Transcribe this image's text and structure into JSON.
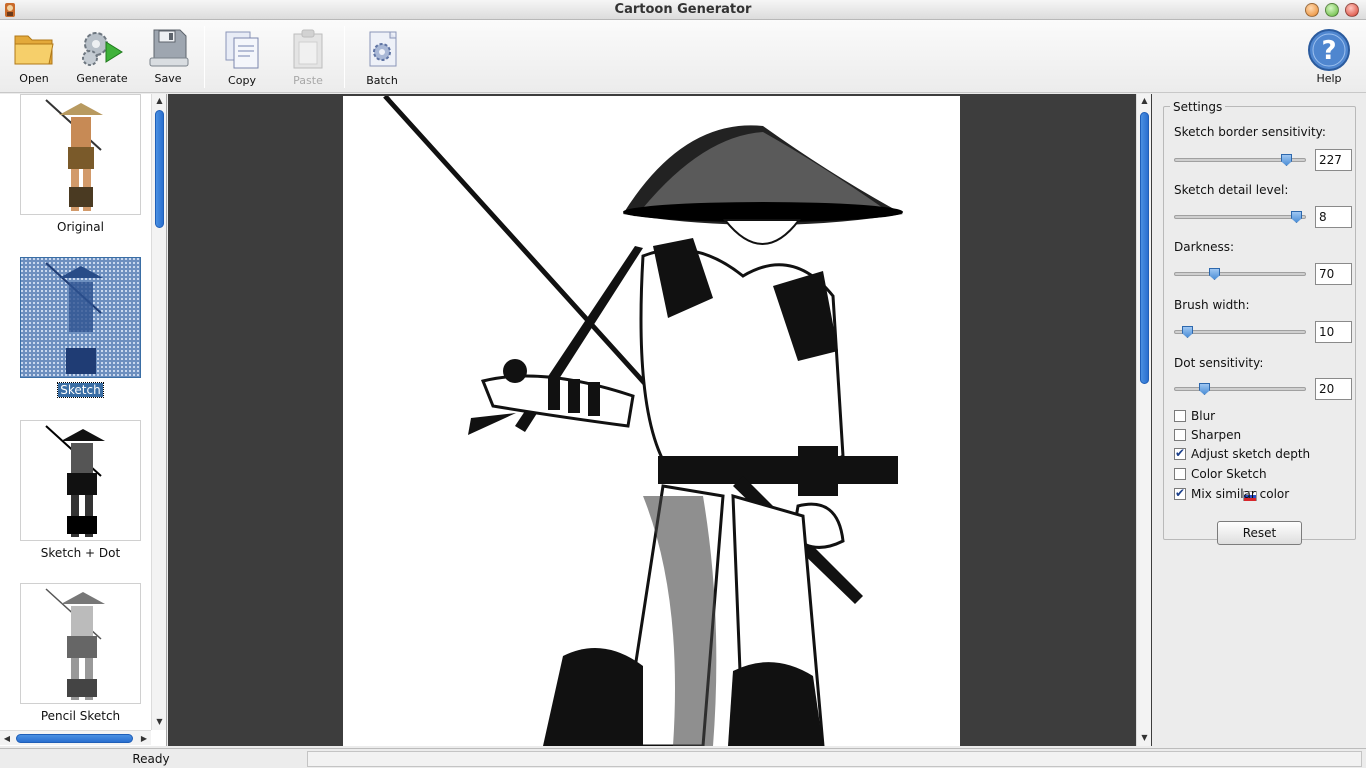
{
  "window": {
    "title": "Cartoon Generator"
  },
  "toolbar": {
    "open": "Open",
    "generate": "Generate",
    "save": "Save",
    "copy": "Copy",
    "paste": "Paste",
    "batch": "Batch",
    "help": "Help"
  },
  "thumbnails": [
    {
      "label": "Original",
      "selected": false
    },
    {
      "label": "Sketch",
      "selected": true
    },
    {
      "label": "Sketch + Dot",
      "selected": false
    },
    {
      "label": "Pencil Sketch",
      "selected": false
    }
  ],
  "settings": {
    "group_title": "Settings",
    "sliders": [
      {
        "label": "Sketch border sensitivity:",
        "value": "227",
        "level": 0.88
      },
      {
        "label": "Sketch detail level:",
        "value": "8",
        "level": 0.96
      },
      {
        "label": "Darkness:",
        "value": "70",
        "level": 0.28
      },
      {
        "label": "Brush width:",
        "value": "10",
        "level": 0.06
      },
      {
        "label": "Dot sensitivity:",
        "value": "20",
        "level": 0.2
      }
    ],
    "checkboxes": [
      {
        "label": "Blur",
        "checked": false
      },
      {
        "label": "Sharpen",
        "checked": false
      },
      {
        "label": "Adjust sketch depth",
        "checked": true
      },
      {
        "label": "Color Sketch",
        "checked": false
      },
      {
        "label": "Mix similar color",
        "checked": true
      }
    ],
    "reset": "Reset"
  },
  "status": {
    "text": "Ready"
  },
  "colors": {
    "accent": "#3a6ea5",
    "scroll": "#2a6fcf",
    "canvas_bg": "#3d3d3d"
  }
}
